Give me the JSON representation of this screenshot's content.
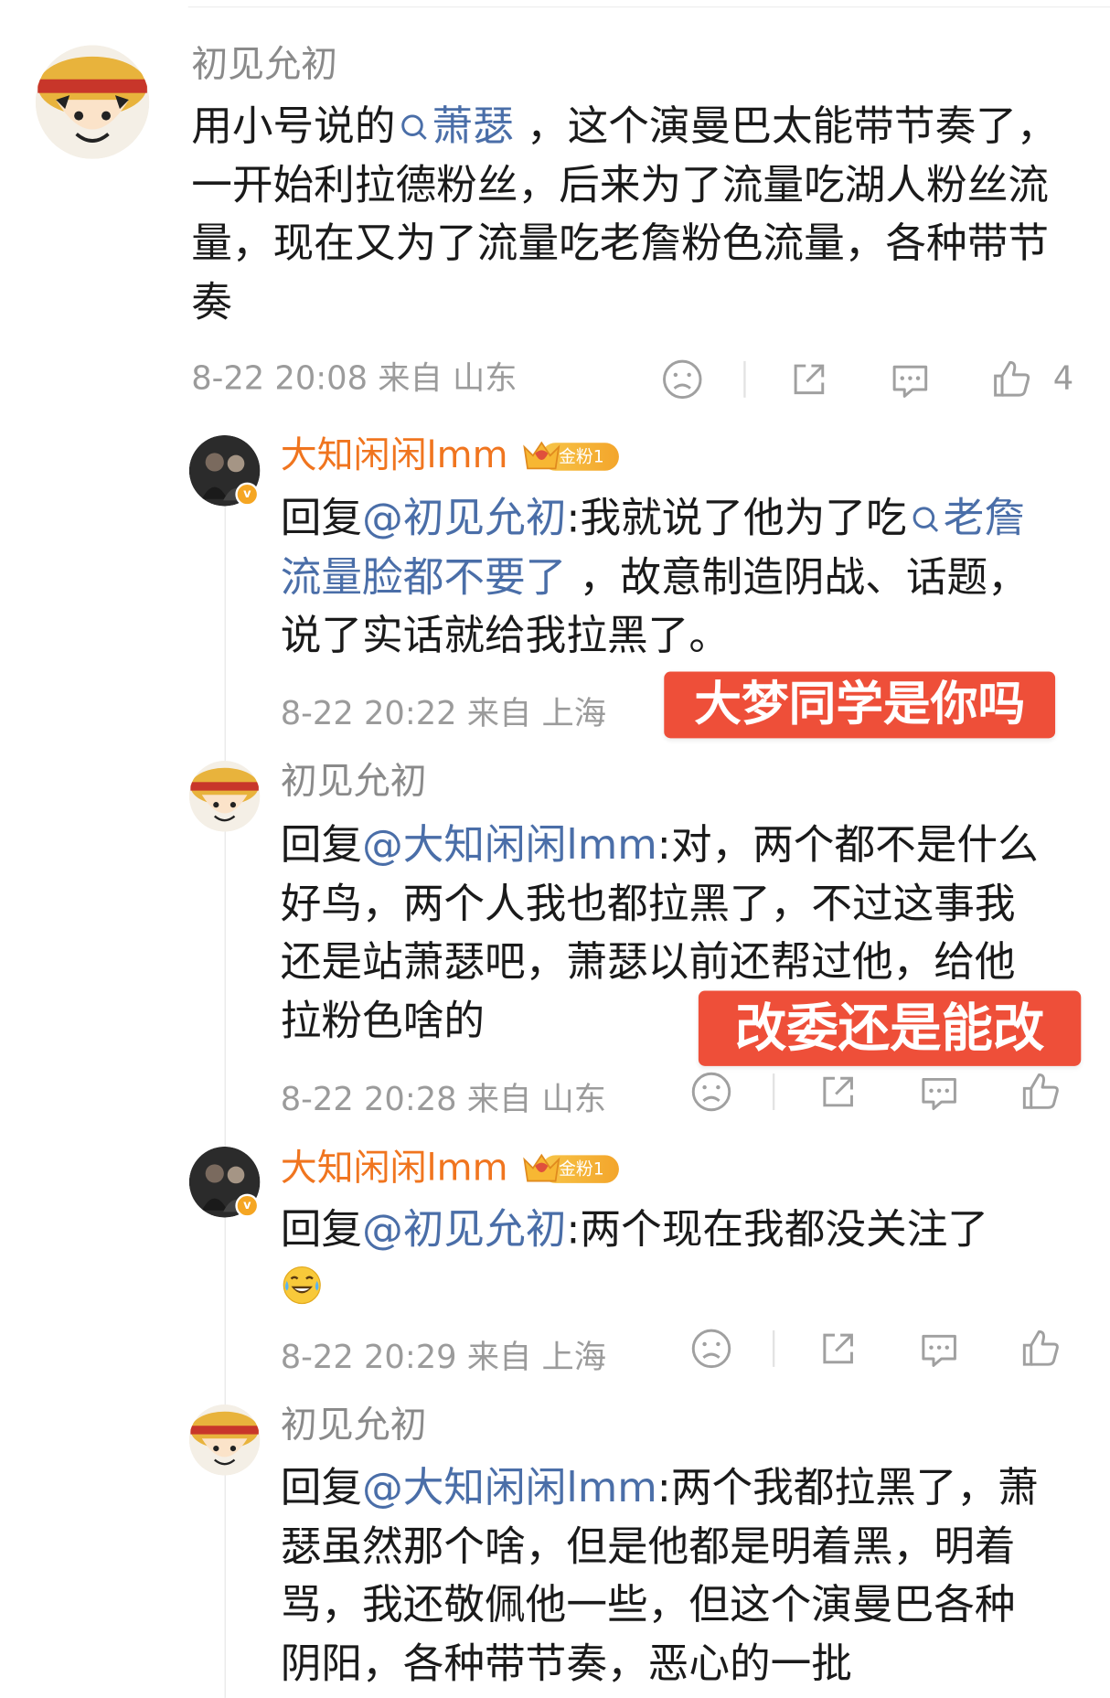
{
  "comments": [
    {
      "username": "初见允初",
      "text_before": "用小号说的",
      "link": "萧瑟",
      "text_after": " ，这个演曼巴太能带节奏了，一开始利拉德粉丝，后来为了流量吃湖人粉丝流量，现在又为了流量吃老詹粉色流量，各种带节奏",
      "time": "8-22 20:08",
      "from": "来自 山东",
      "like_count": "4"
    },
    {
      "username": "大知闲闲lmm",
      "badge": "金粉1",
      "reply_prefix": "回复",
      "reply_to": "@初见允初",
      "text_before": ":我就说了他为了吃",
      "link": "老詹流量脸都不要了",
      "text_after": " ，故意制造阴战、话题，说了实话就给我拉黑了。",
      "time": "8-22 20:22",
      "from": "来自 上海",
      "sticker": "大梦同学是你吗"
    },
    {
      "username": "初见允初",
      "reply_prefix": "回复",
      "reply_to": "@大知闲闲lmm",
      "text": ":对，两个都不是什么好鸟，两个人我也都拉黑了，不过这事我还是站萧瑟吧，萧瑟以前还帮过他，给他拉粉色啥的",
      "time": "8-22 20:28",
      "from": "来自 山东",
      "sticker": "改委还是能改"
    },
    {
      "username": "大知闲闲lmm",
      "badge": "金粉1",
      "reply_prefix": "回复",
      "reply_to": "@初见允初",
      "text": ":两个现在我都没关注了",
      "emoji": "tears-of-joy-emoji",
      "time": "8-22 20:29",
      "from": "来自 上海"
    },
    {
      "username": "初见允初",
      "reply_prefix": "回复",
      "reply_to": "@大知闲闲lmm",
      "text": ":两个我都拉黑了，萧瑟虽然那个啥，但是他都是明着黑，明着骂，我还敬佩他一些，但这个演曼巴各种阴阳，各种带节奏，恶心的一批"
    }
  ],
  "icons": {
    "dislike": "dislike-face-icon",
    "share": "share-icon",
    "reply": "comment-icon",
    "like": "thumbs-up-icon",
    "search": "search-icon"
  },
  "colors": {
    "link": "#4a6ea8",
    "vip_name": "#f0751f",
    "sticker": "#ee4f39",
    "meta": "#9b9b9b"
  }
}
